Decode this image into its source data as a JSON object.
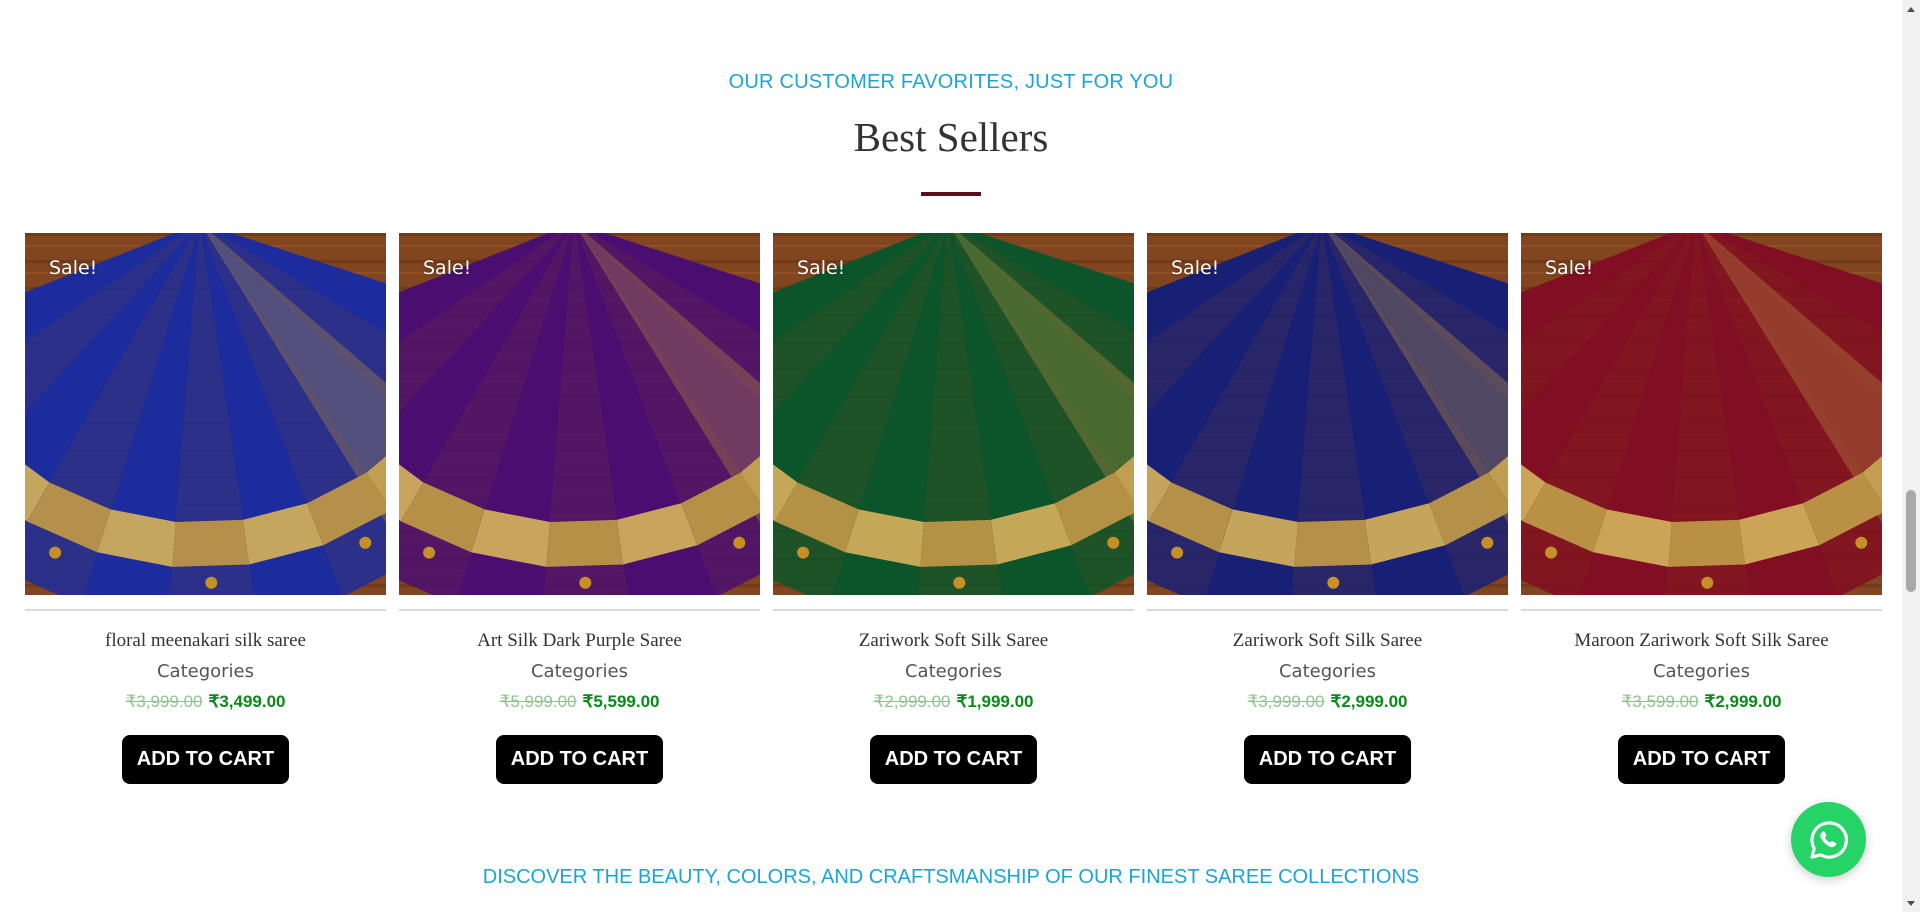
{
  "section": {
    "eyebrow": "OUR CUSTOMER FAVORITES, JUST FOR YOU",
    "title": "Best Sellers",
    "tagline": "DISCOVER THE BEAUTY, COLORS, AND CRAFTSMANSHIP OF OUR FINEST SAREE COLLECTIONS"
  },
  "products": [
    {
      "badge": "Sale!",
      "name": "floral meenakari silk saree",
      "category": "Categories",
      "old_price": "₹3,999.00",
      "price": "₹3,499.00",
      "button": "ADD TO CART",
      "color": "#1f2fa6",
      "image_icon": "saree-image-icon"
    },
    {
      "badge": "Sale!",
      "name": "Art Silk Dark Purple Saree",
      "category": "Categories",
      "old_price": "₹5,999.00",
      "price": "₹5,599.00",
      "button": "ADD TO CART",
      "color": "#4f0f78",
      "image_icon": "saree-image-icon"
    },
    {
      "badge": "Sale!",
      "name": "Zariwork Soft Silk Saree",
      "category": "Categories",
      "old_price": "₹2,999.00",
      "price": "₹1,999.00",
      "button": "ADD TO CART",
      "color": "#0d5a2c",
      "image_icon": "saree-image-icon"
    },
    {
      "badge": "Sale!",
      "name": "Zariwork Soft Silk Saree",
      "category": "Categories",
      "old_price": "₹3,999.00",
      "price": "₹2,999.00",
      "button": "ADD TO CART",
      "color": "#1a237e",
      "image_icon": "saree-image-icon"
    },
    {
      "badge": "Sale!",
      "name": "Maroon Zariwork Soft Silk Saree",
      "category": "Categories",
      "old_price": "₹3,599.00",
      "price": "₹2,999.00",
      "button": "ADD TO CART",
      "color": "#8a0f25",
      "image_icon": "saree-image-icon"
    }
  ],
  "colors": {
    "accent": "#1aa5d6",
    "rule": "#5a0e1a",
    "sale_price": "#0a8a1a",
    "whatsapp": "#25d366"
  },
  "whatsapp_icon": "whatsapp-icon"
}
